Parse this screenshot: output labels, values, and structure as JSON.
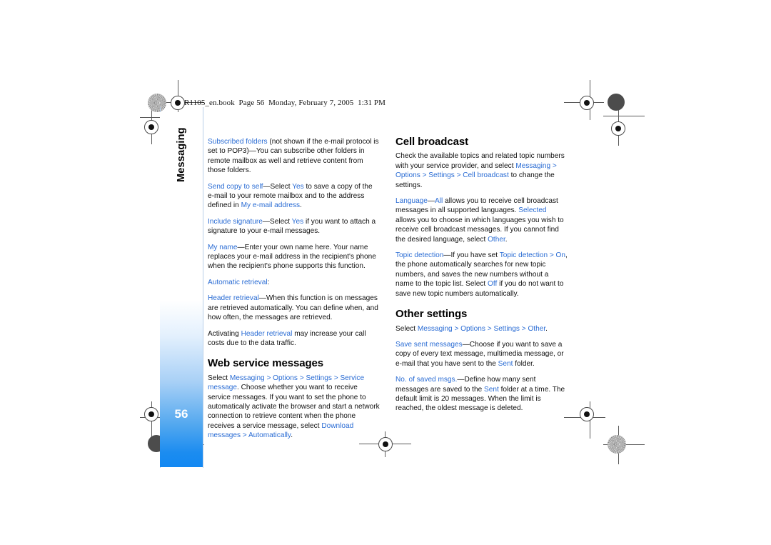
{
  "document": {
    "book_header": "R1105_en.book  Page 56  Monday, February 7, 2005  1:31 PM",
    "chapter_tab": "Messaging",
    "page_number": "56",
    "accent_color": "#2a6cd4",
    "tab_color": "#1288f2"
  },
  "left_column": {
    "p_subscribed_folders": {
      "term": "Subscribed folders",
      "rest": " (not shown if the e-mail protocol is set to POP3)—You can subscribe other folders in remote mailbox as well and retrieve content from those folders."
    },
    "p_send_copy": {
      "term": "Send copy to self",
      "part1": "—Select ",
      "yes": "Yes",
      "part2": " to save a copy of the e-mail to your remote mailbox and to the address defined in ",
      "term2": "My e-mail address",
      "part3": "."
    },
    "p_include_signature": {
      "term": "Include signature",
      "part1": "—Select ",
      "yes": "Yes",
      "part2": " if you want to attach a signature to your e-mail messages."
    },
    "p_my_name": {
      "term": "My name",
      "rest": "—Enter your own name here. Your name replaces your e-mail address in the recipient's phone when the recipient's phone supports this function."
    },
    "p_automatic_retrieval": {
      "term": "Automatic retrieval",
      "rest": ":"
    },
    "p_header_retrieval": {
      "term": "Header retrieval",
      "rest": "—When this function is on messages are retrieved automatically. You can define when, and how often, the messages are retrieved."
    },
    "p_activating": {
      "part1": "Activating ",
      "term": "Header retrieval",
      "part2": " may increase your call costs due to the data traffic."
    },
    "heading_web_service": "Web service messages",
    "p_web_service": {
      "part1": "Select ",
      "path": "Messaging > Options > Settings > Service message",
      "part2": ". Choose whether you want to receive service messages. If you want to set the phone to automatically activate the browser and start a network connection to retrieve content when the phone receives a service message, select ",
      "path2": "Download messages > Automatically",
      "part3": "."
    }
  },
  "right_column": {
    "heading_cell_broadcast": "Cell broadcast",
    "p_cell_broadcast": {
      "part1": "Check the available topics and related topic numbers with your service provider, and select ",
      "path": "Messaging > Options > Settings > Cell broadcast",
      "part2": " to change the settings."
    },
    "p_language": {
      "term": "Language",
      "dash": "—",
      "all": "All",
      "part1": " allows you to receive cell broadcast messages in all supported languages. ",
      "selected": "Selected",
      "part2": " allows you to choose in which languages you wish to receive cell broadcast messages. If you cannot find the desired language, select ",
      "other": "Other",
      "part3": "."
    },
    "p_topic_detection": {
      "term": "Topic detection",
      "part1": "—If you have set ",
      "path": "Topic detection > On",
      "part2": ", the phone automatically searches for new topic numbers, and saves the new numbers without a name to the topic list. Select ",
      "off": "Off",
      "part3": " if you do not want to save new topic numbers automatically."
    },
    "heading_other_settings": "Other settings",
    "p_select_other": {
      "part1": "Select ",
      "path": "Messaging > Options > Settings > Other",
      "part2": "."
    },
    "p_save_sent": {
      "term": "Save sent messages",
      "part1": "—Choose if you want to save a copy of every text message, multimedia message, or e-mail that you have sent to the ",
      "sent": "Sent",
      "part2": " folder."
    },
    "p_no_saved": {
      "term": "No. of saved msgs.",
      "part1": "—Define how many sent messages are saved to the ",
      "sent": "Sent",
      "part2": " folder at a time. The default limit is 20 messages. When the limit is reached, the oldest message is deleted."
    }
  }
}
